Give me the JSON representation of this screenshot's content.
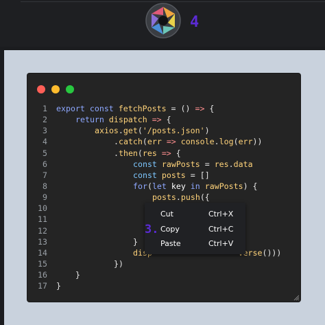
{
  "step": {
    "number": "4",
    "menu_marker": "3."
  },
  "window": {
    "traffic_lights": [
      "#ff5f57",
      "#febc2e",
      "#28c840"
    ]
  },
  "code": {
    "lines": [
      {
        "n": "1",
        "indent": 0,
        "tokens": [
          [
            "kw",
            "export "
          ],
          [
            "kw",
            "const "
          ],
          [
            "fn",
            "fetchPosts"
          ],
          [
            "id",
            " = () "
          ],
          [
            "op",
            "=>"
          ],
          [
            "id",
            " {"
          ]
        ]
      },
      {
        "n": "2",
        "indent": 4,
        "tokens": [
          [
            "kw",
            "return "
          ],
          [
            "fn",
            "dispatch"
          ],
          [
            "id",
            " "
          ],
          [
            "op",
            "=>"
          ],
          [
            "id",
            " {"
          ]
        ]
      },
      {
        "n": "3",
        "indent": 8,
        "tokens": [
          [
            "fn",
            "axios"
          ],
          [
            "id",
            "."
          ],
          [
            "fn",
            "get"
          ],
          [
            "id",
            "("
          ],
          [
            "str",
            "'/posts.json'"
          ],
          [
            "id",
            ")"
          ]
        ]
      },
      {
        "n": "4",
        "indent": 12,
        "tokens": [
          [
            "id",
            "."
          ],
          [
            "fn",
            "catch"
          ],
          [
            "id",
            "("
          ],
          [
            "fn",
            "err"
          ],
          [
            "id",
            " "
          ],
          [
            "op",
            "=>"
          ],
          [
            "id",
            " "
          ],
          [
            "fn",
            "console"
          ],
          [
            "id",
            "."
          ],
          [
            "fn",
            "log"
          ],
          [
            "id",
            "("
          ],
          [
            "fn",
            "err"
          ],
          [
            "id",
            "))"
          ]
        ]
      },
      {
        "n": "5",
        "indent": 12,
        "tokens": [
          [
            "id",
            "."
          ],
          [
            "fn",
            "then"
          ],
          [
            "id",
            "("
          ],
          [
            "fn",
            "res"
          ],
          [
            "id",
            " "
          ],
          [
            "op",
            "=>"
          ],
          [
            "id",
            " {"
          ]
        ]
      },
      {
        "n": "6",
        "indent": 16,
        "tokens": [
          [
            "ct",
            "const "
          ],
          [
            "fn",
            "rawPosts"
          ],
          [
            "id",
            " = "
          ],
          [
            "fn",
            "res"
          ],
          [
            "id",
            "."
          ],
          [
            "fn",
            "data"
          ]
        ]
      },
      {
        "n": "7",
        "indent": 16,
        "tokens": [
          [
            "ct",
            "const "
          ],
          [
            "fn",
            "posts"
          ],
          [
            "id",
            " = []"
          ]
        ]
      },
      {
        "n": "8",
        "indent": 16,
        "tokens": [
          [
            "kw",
            "for"
          ],
          [
            "id",
            "("
          ],
          [
            "kw",
            "let "
          ],
          [
            "pr",
            "key"
          ],
          [
            "id",
            " "
          ],
          [
            "kw",
            "in "
          ],
          [
            "fn",
            "rawPosts"
          ],
          [
            "id",
            ") {"
          ]
        ]
      },
      {
        "n": "9",
        "indent": 20,
        "tokens": [
          [
            "fn",
            "posts"
          ],
          [
            "id",
            "."
          ],
          [
            "fn",
            "push"
          ],
          [
            "id",
            "({"
          ]
        ]
      },
      {
        "n": "10",
        "indent": 0,
        "tokens": []
      },
      {
        "n": "11",
        "indent": 0,
        "tokens": []
      },
      {
        "n": "12",
        "indent": 0,
        "tokens": []
      },
      {
        "n": "13",
        "indent": 16,
        "tokens": [
          [
            "id",
            "}"
          ]
        ]
      },
      {
        "n": "14",
        "indent": 16,
        "tokens": [
          [
            "fn",
            "disp"
          ],
          [
            "id",
            "                  "
          ],
          [
            "fn",
            "verse"
          ],
          [
            "id",
            "()))"
          ]
        ]
      },
      {
        "n": "15",
        "indent": 12,
        "tokens": [
          [
            "id",
            "})"
          ]
        ]
      },
      {
        "n": "16",
        "indent": 4,
        "tokens": [
          [
            "id",
            "}"
          ]
        ]
      },
      {
        "n": "17",
        "indent": 0,
        "tokens": [
          [
            "id",
            "}"
          ]
        ]
      }
    ]
  },
  "context_menu": {
    "items": [
      {
        "label": "Cut",
        "shortcut": "Ctrl+X"
      },
      {
        "label": "Copy",
        "shortcut": "Ctrl+C"
      },
      {
        "label": "Paste",
        "shortcut": "Ctrl+V"
      }
    ]
  }
}
